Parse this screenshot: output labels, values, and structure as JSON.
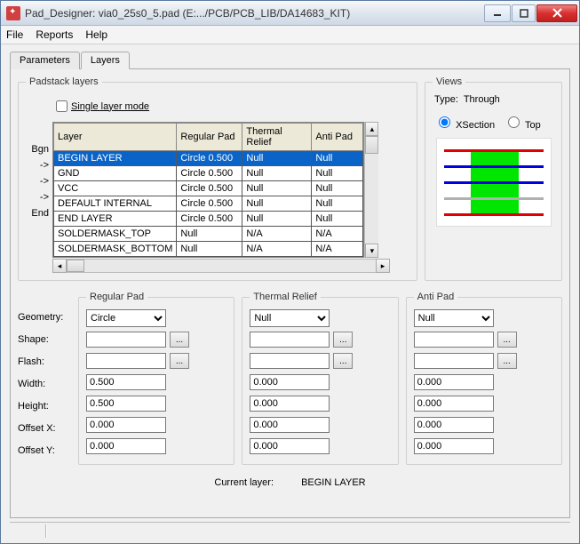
{
  "window": {
    "title": "Pad_Designer: via0_25s0_5.pad (E:.../PCB/PCB_LIB/DA14683_KIT)"
  },
  "menu": {
    "file": "File",
    "reports": "Reports",
    "help": "Help"
  },
  "tabs": {
    "parameters": "Parameters",
    "layers": "Layers"
  },
  "padstack": {
    "legend": "Padstack layers",
    "single_mode_label": "Single layer mode",
    "headers": {
      "layer": "Layer",
      "regular": "Regular Pad",
      "thermal": "Thermal Relief",
      "anti": "Anti Pad"
    },
    "rowlabels": [
      "Bgn",
      "->",
      "->",
      "->",
      "End",
      "",
      ""
    ],
    "rows": [
      {
        "layer": "BEGIN LAYER",
        "regular": "Circle 0.500",
        "thermal": "Null",
        "anti": "Null",
        "selected": true
      },
      {
        "layer": "GND",
        "regular": "Circle 0.500",
        "thermal": "Null",
        "anti": "Null"
      },
      {
        "layer": "VCC",
        "regular": "Circle 0.500",
        "thermal": "Null",
        "anti": "Null"
      },
      {
        "layer": "DEFAULT INTERNAL",
        "regular": "Circle 0.500",
        "thermal": "Null",
        "anti": "Null"
      },
      {
        "layer": "END LAYER",
        "regular": "Circle 0.500",
        "thermal": "Null",
        "anti": "Null"
      },
      {
        "layer": "SOLDERMASK_TOP",
        "regular": "Null",
        "thermal": "N/A",
        "anti": "N/A"
      },
      {
        "layer": "SOLDERMASK_BOTTOM",
        "regular": "Null",
        "thermal": "N/A",
        "anti": "N/A"
      }
    ]
  },
  "views": {
    "legend": "Views",
    "type_label": "Type:",
    "type_value": "Through",
    "xsection_label": "XSection",
    "top_label": "Top"
  },
  "labels": {
    "geometry": "Geometry:",
    "shape": "Shape:",
    "flash": "Flash:",
    "width": "Width:",
    "height": "Height:",
    "offsetx": "Offset X:",
    "offsety": "Offset Y:"
  },
  "regular_pad": {
    "legend": "Regular Pad",
    "geometry": "Circle",
    "shape": "",
    "flash": "",
    "width": "0.500",
    "height": "0.500",
    "offsetx": "0.000",
    "offsety": "0.000"
  },
  "thermal_relief": {
    "legend": "Thermal Relief",
    "geometry": "Null",
    "shape": "",
    "flash": "",
    "width": "0.000",
    "height": "0.000",
    "offsetx": "0.000",
    "offsety": "0.000"
  },
  "anti_pad": {
    "legend": "Anti Pad",
    "geometry": "Null",
    "shape": "",
    "flash": "",
    "width": "0.000",
    "height": "0.000",
    "offsetx": "0.000",
    "offsety": "0.000"
  },
  "current": {
    "label": "Current layer:",
    "value": "BEGIN LAYER"
  },
  "misc": {
    "ellipsis": "..."
  }
}
